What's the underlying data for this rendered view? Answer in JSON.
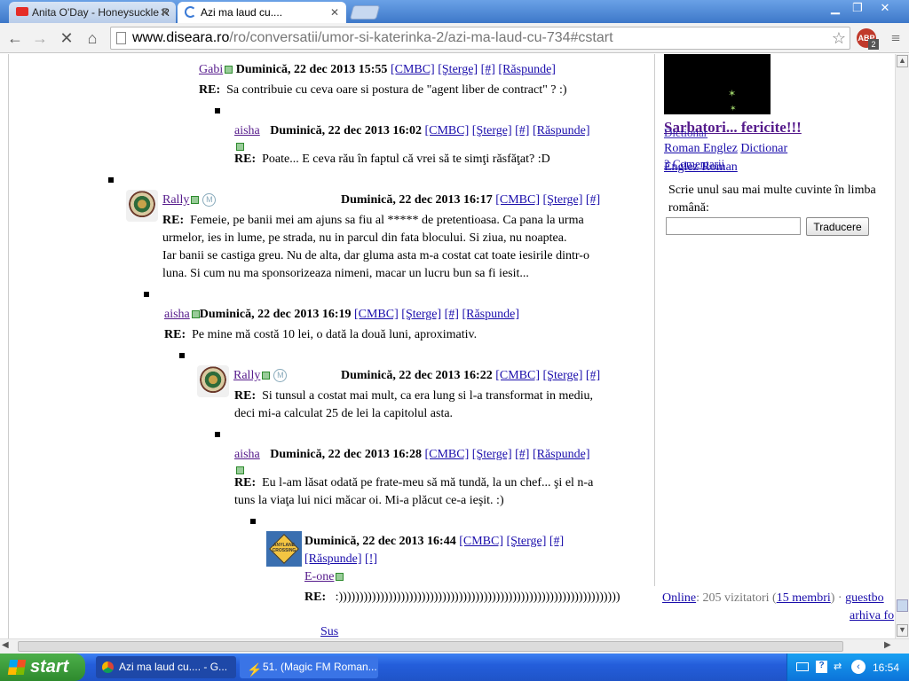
{
  "browser": {
    "tabs": [
      {
        "label": "Anita O'Day - Honeysuckle R"
      },
      {
        "label": "Azi ma laud cu...."
      }
    ],
    "url_host": "www.diseara.ro",
    "url_path": "/ro/conversatii/umor-si-katerinka-2/azi-ma-laud-cu-734#cstart",
    "abp_badge": "2"
  },
  "comments": [
    {
      "author": "Gabi",
      "meta": "Duminică, 22 dec 2013 15:55",
      "links": [
        "[CMBC]",
        "[Şterge]",
        "[#]",
        "[Răspunde]"
      ],
      "re": "RE:",
      "text": [
        "Sa contribuie cu ceva oare si postura de \"agent liber de contract\" ? :)"
      ]
    },
    {
      "author": "aisha",
      "meta": "Duminică, 22 dec 2013 16:02",
      "links": [
        "[CMBC]",
        "[Şterge]",
        "[#]",
        "[Răspunde]"
      ],
      "re": "RE:",
      "text": [
        "Poate... E ceva rău în faptul că vrei să te simţi răsfăţat? :D"
      ]
    },
    {
      "author": "Rally",
      "badge": "M",
      "meta": "Duminică, 22 dec 2013 16:17",
      "links": [
        "[CMBC]",
        "[Şterge]",
        "[#]"
      ],
      "re": "RE:",
      "text": [
        "Femeie, pe banii mei am ajuns sa fiu al ***** de pretentioasa. Ca pana la urma",
        "urmelor, ies in lume, pe strada, nu in parcul din fata blocului. Si ziua, nu noaptea.",
        "Iar banii se castiga greu. Nu de alta, dar gluma asta m-a costat cat toate iesirile dintr-o",
        "luna. Si cum nu ma sponsorizeaza nimeni, macar un lucru bun sa fi iesit..."
      ]
    },
    {
      "author": "aisha",
      "meta": "Duminică, 22 dec 2013 16:19",
      "links": [
        "[CMBC]",
        "[Şterge]",
        "[#]",
        "[Răspunde]"
      ],
      "re": "RE:",
      "text": [
        "Pe mine mă costă 10 lei, o dată la două luni, aproximativ."
      ]
    },
    {
      "author": "Rally",
      "badge": "M",
      "meta": "Duminică, 22 dec 2013 16:22",
      "links": [
        "[CMBC]",
        "[Şterge]",
        "[#]"
      ],
      "re": "RE:",
      "text": [
        "Si tunsul a costat mai mult, ca era lung si l-a transformat in mediu,",
        "deci mi-a calculat 25 de lei la capitolul asta."
      ]
    },
    {
      "author": "aisha",
      "meta": "Duminică, 22 dec 2013 16:28",
      "links": [
        "[CMBC]",
        "[Şterge]",
        "[#]",
        "[Răspunde]"
      ],
      "re": "RE:",
      "text": [
        "Eu l-am lăsat odată pe frate-meu să mă tundă, la un chef... şi el n-a",
        "tuns la viaţa lui nici măcar oi. Mi-a plăcut ce-a ieşit. :)"
      ]
    },
    {
      "author": "E-one",
      "meta": "Duminică, 22 dec 2013 16:44",
      "links": [
        "[CMBC]",
        "[Şterge]",
        "[#]",
        "[Răspunde]",
        "[!]"
      ],
      "re": "RE:",
      "text": [
        ":))))))))))))))))))))))))))))))))))))))))))))))))))))))))))))))))))))"
      ],
      "avatar_text": "ANYLANE CROSSING"
    }
  ],
  "back_to_top": "Sus",
  "sidebar": {
    "title": "Sarbatori... fericite!!!",
    "links": [
      "Dictionar",
      "Roman Englez",
      "Dictionar",
      "3 Comentarii",
      "Englez Roman"
    ],
    "translate_prompt": "Scrie unul sau mai multe cuvinte în limba română:",
    "translate_button": "Traducere",
    "input_value": ""
  },
  "footer": {
    "online": "Online",
    "visitors": ": 205 vizitatori (",
    "members": "15 membri",
    "after": ") · ",
    "guestbook": "guestbo",
    "archive": "arhiva fo"
  },
  "taskbar": {
    "start": "start",
    "items": [
      {
        "label": "Azi ma laud cu.... - G..."
      },
      {
        "label": "51. (Magic FM Roman..."
      }
    ],
    "clock": "16:54"
  }
}
